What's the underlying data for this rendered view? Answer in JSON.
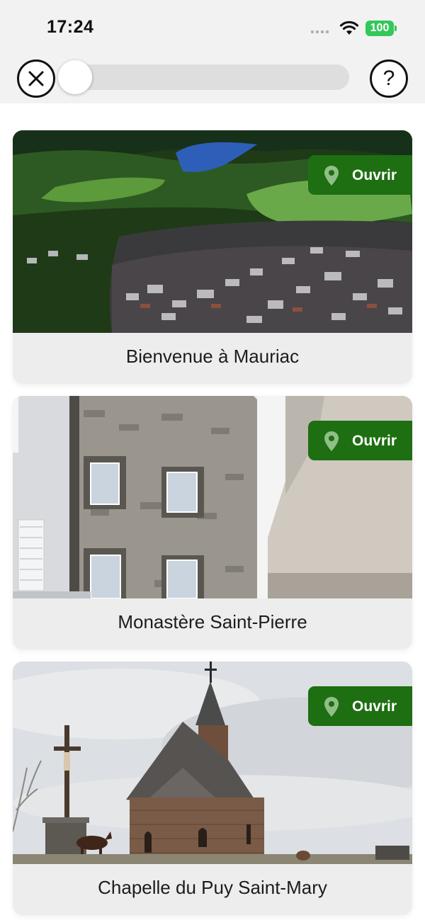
{
  "status_bar": {
    "time": "17:24",
    "battery": "100"
  },
  "header": {
    "help_label": "?",
    "progress": 0.0
  },
  "cards": [
    {
      "title": "Bienvenue à Mauriac",
      "open_label": "Ouvrir"
    },
    {
      "title": "Monastère Saint-Pierre",
      "open_label": "Ouvrir"
    },
    {
      "title": "Chapelle du Puy Saint-Mary",
      "open_label": "Ouvrir"
    }
  ],
  "icons": {
    "close": "close-icon",
    "help": "help-icon",
    "pin": "map-pin-icon",
    "wifi": "wifi-icon",
    "signal": "signal-icon",
    "battery": "battery-icon"
  },
  "colors": {
    "accent": "#1e6e12",
    "battery": "#34c759",
    "card_bg": "#eeeded"
  }
}
